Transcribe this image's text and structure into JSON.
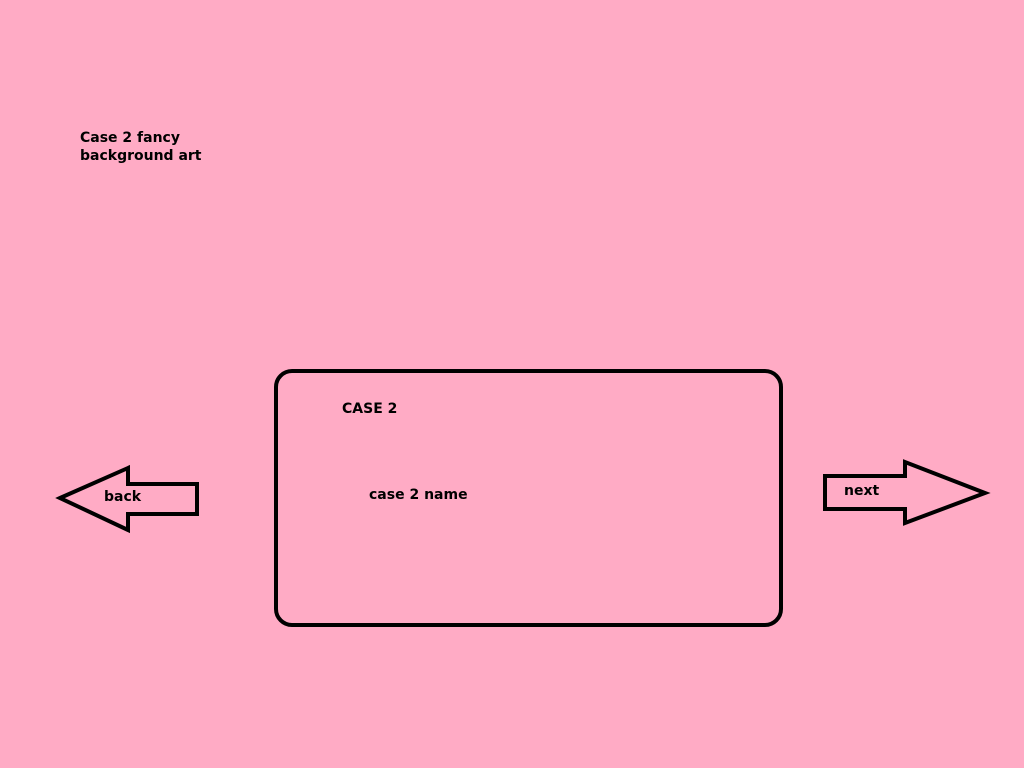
{
  "background_art": {
    "text": "Case 2 fancy\nbackground art"
  },
  "case_card": {
    "title": "CASE 2",
    "name": "case 2 name"
  },
  "navigation": {
    "back_label": "back",
    "next_label": "next"
  },
  "colors": {
    "background": "#ffabc5",
    "outline": "#000000"
  }
}
